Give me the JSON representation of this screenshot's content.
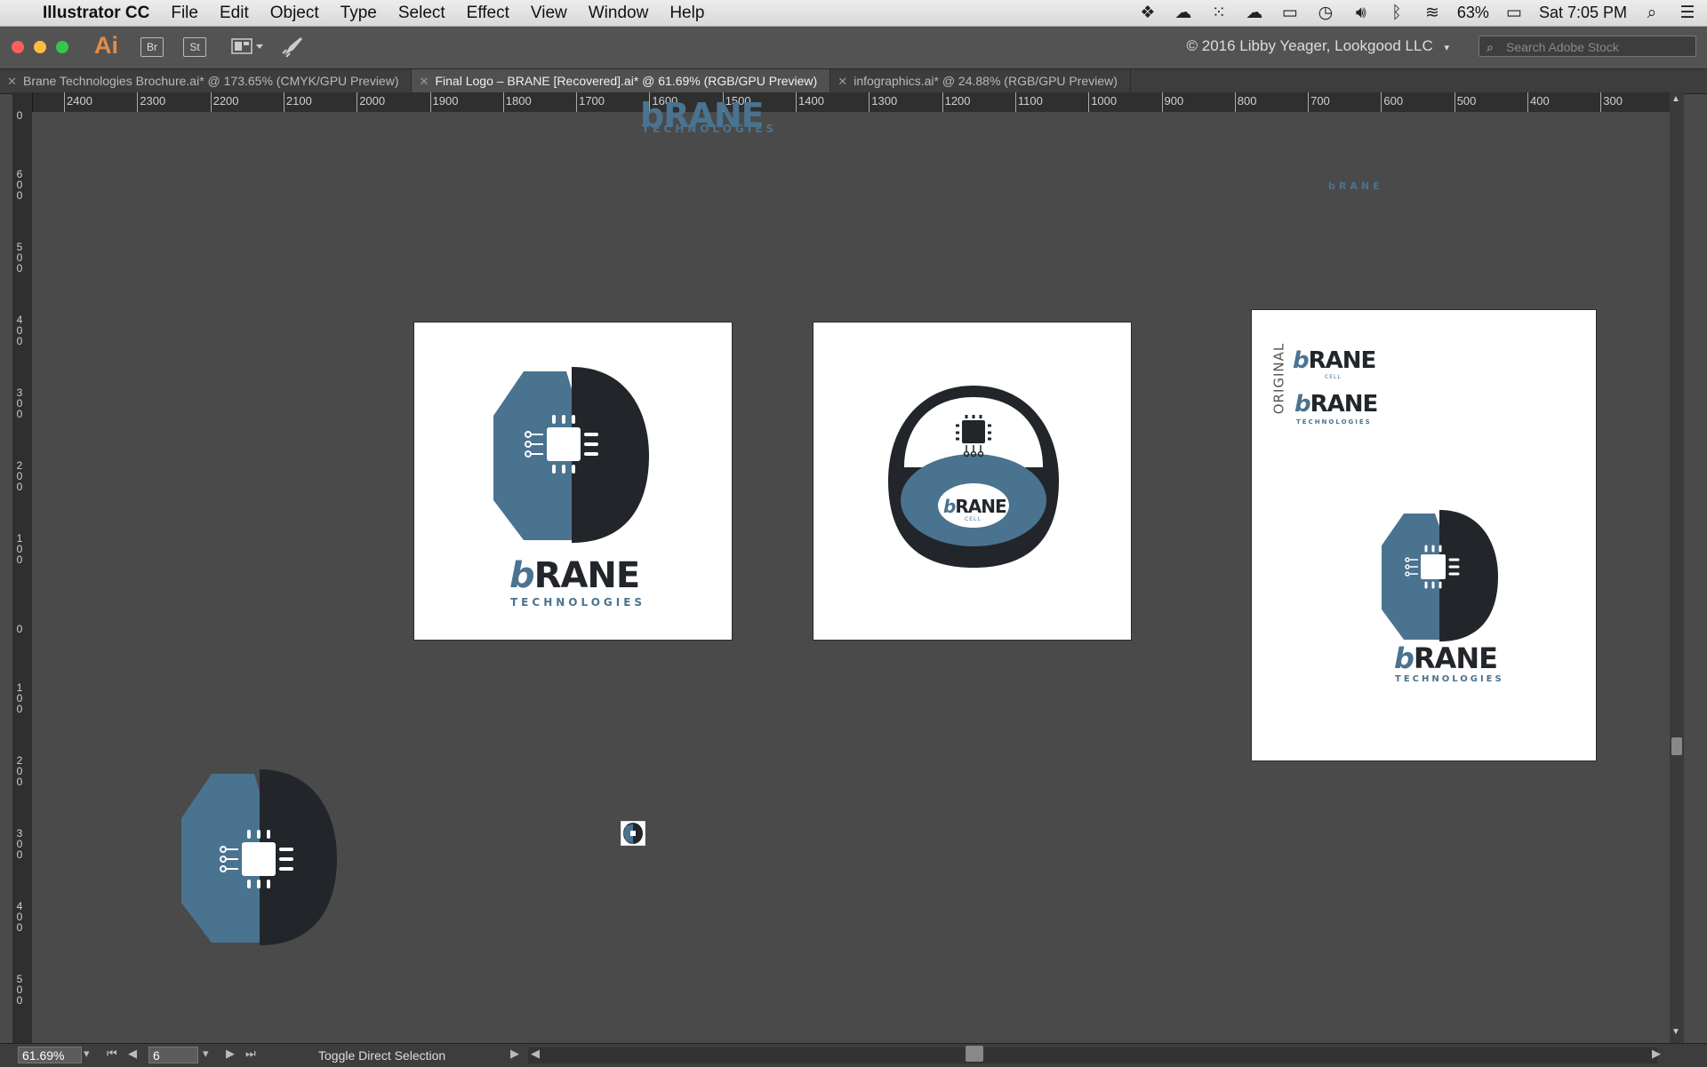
{
  "menubar": {
    "app_name": "Illustrator CC",
    "items": [
      "File",
      "Edit",
      "Object",
      "Type",
      "Select",
      "Effect",
      "View",
      "Window",
      "Help"
    ],
    "battery": "63%",
    "clock": "Sat 7:05 PM"
  },
  "appbar": {
    "app_icon": "Ai",
    "bridge_label": "Br",
    "stock_label": "St",
    "copyright": "© 2016 Libby Yeager, Lookgood LLC",
    "search_placeholder": "Search Adobe Stock"
  },
  "tabs": [
    {
      "label": "Brane Technologies Brochure.ai* @ 173.65% (CMYK/GPU Preview)",
      "active": false
    },
    {
      "label": "Final Logo – BRANE [Recovered].ai* @ 61.69% (RGB/GPU Preview)",
      "active": true
    },
    {
      "label": "infographics.ai* @ 24.88% (RGB/GPU Preview)",
      "active": false
    }
  ],
  "ruler": {
    "h_labels": [
      "2400",
      "2300",
      "2200",
      "2100",
      "2000",
      "1900",
      "1800",
      "1700",
      "1600",
      "1500",
      "1400",
      "1300",
      "1200",
      "1100",
      "1000",
      "900",
      "800",
      "700",
      "600",
      "500",
      "400",
      "300"
    ],
    "v_labels": [
      "0",
      "600",
      "500",
      "400",
      "300",
      "200",
      "100",
      "0",
      "100",
      "200",
      "300",
      "400",
      "500"
    ]
  },
  "canvas": {
    "top_wordmark": "bRANE",
    "top_tagline": "TECHNOLOGIES",
    "small_mark": "bRANE",
    "artboard1": {
      "wordmark_b": "b",
      "wordmark_rest": "RANE",
      "tagline": "TECHNOLOGIES"
    },
    "artboard2": {
      "wordmark_b": "b",
      "wordmark_rest": "RANE",
      "tagline": "CELL"
    },
    "artboard3": {
      "side_label": "ORIGINAL",
      "logo1_b": "b",
      "logo1_rest": "RANE",
      "logo1_tag": "CELL",
      "logo2_b": "b",
      "logo2_rest": "RANE",
      "logo2_tag": "TECHNOLOGIES",
      "main_b": "b",
      "main_rest": "RANE",
      "main_tag": "TECHNOLOGIES"
    }
  },
  "statusbar": {
    "zoom": "61.69%",
    "artboard_num": "6",
    "status_text": "Toggle Direct Selection"
  },
  "colors": {
    "brand_blue": "#4a7390",
    "brand_dark": "#22262a"
  }
}
